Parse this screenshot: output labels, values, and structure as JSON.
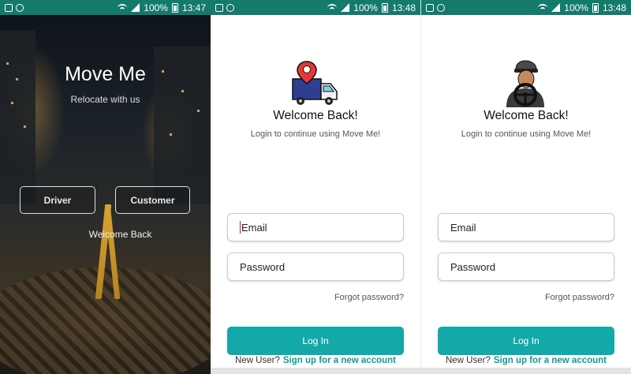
{
  "screens": [
    {
      "status": {
        "battery": "100%",
        "time": "13:47"
      },
      "title": "Move Me",
      "tagline": "Relocate with us",
      "buttons": {
        "driver": "Driver",
        "customer": "Customer"
      },
      "welcome_back": "Welcome Back"
    },
    {
      "status": {
        "battery": "100%",
        "time": "13:48"
      },
      "logo_icon": "delivery-truck-location-icon",
      "heading": "Welcome Back!",
      "subtitle": "Login to continue using Move Me!",
      "email_placeholder": "Email",
      "password_placeholder": "Password",
      "forgot": "Forgot password?",
      "login": "Log In",
      "new_user": "New User?",
      "signup": "Sign up for a new account"
    },
    {
      "status": {
        "battery": "100%",
        "time": "13:48"
      },
      "logo_icon": "driver-with-steering-wheel-icon",
      "heading": "Welcome Back!",
      "subtitle": "Login to continue using Move Me!",
      "email_placeholder": "Email",
      "password_placeholder": "Password",
      "forgot": "Forgot password?",
      "login": "Log In",
      "new_user": "New User?",
      "signup": "Sign up for a new account"
    }
  ],
  "colors": {
    "statusbar": "#147a6b",
    "accent": "#12a9a8",
    "link": "#0f9a94"
  }
}
